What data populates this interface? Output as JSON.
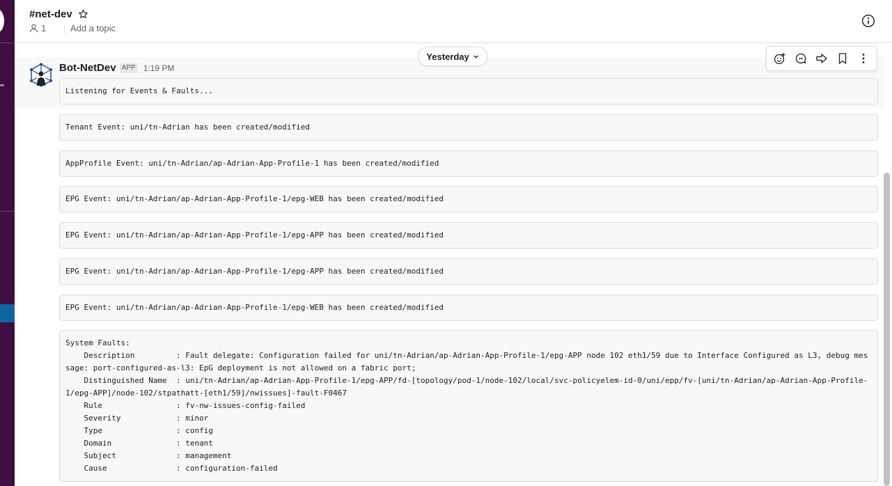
{
  "channel": {
    "name": "#net-dev",
    "member_count": "1",
    "topic_placeholder": "Add a topic"
  },
  "date_divider": {
    "label": "Yesterday"
  },
  "message": {
    "sender": "Bot-NetDev",
    "badge": "APP",
    "time": "1:19 PM"
  },
  "blocks": [
    "Listening for Events & Faults...",
    "Tenant Event: uni/tn-Adrian has been created/modified",
    "AppProfile Event: uni/tn-Adrian/ap-Adrian-App-Profile-1 has been created/modified",
    "EPG Event: uni/tn-Adrian/ap-Adrian-App-Profile-1/epg-WEB has been created/modified",
    "EPG Event: uni/tn-Adrian/ap-Adrian-App-Profile-1/epg-APP has been created/modified",
    "EPG Event: uni/tn-Adrian/ap-Adrian-App-Profile-1/epg-APP has been created/modified",
    "EPG Event: uni/tn-Adrian/ap-Adrian-App-Profile-1/epg-WEB has been created/modified",
    "System Faults:\n    Description         : Fault delegate: Configuration failed for uni/tn-Adrian/ap-Adrian-App-Profile-1/epg-APP node 102 eth1/59 due to Interface Configured as L3, debug message: port-configured-as-l3: EpG deployment is not allowed on a fabric port;\n    Distinguished Name  : uni/tn-Adrian/ap-Adrian-App-Profile-1/epg-APP/fd-[topology/pod-1/node-102/local/svc-policyelem-id-0/uni/epp/fv-[uni/tn-Adrian/ap-Adrian-App-Profile-1/epg-APP]/node-102/stpathatt-[eth1/59]/nwissues]-fault-F0467\n    Rule                : fv-nw-issues-config-failed\n    Severity            : minor\n    Type                : config\n    Domain              : tenant\n    Subject             : management\n    Cause               : configuration-failed"
  ],
  "icons": {
    "star": "star-icon",
    "members": "person-icon",
    "info": "info-icon",
    "actions": [
      "add-reaction-icon",
      "reply-in-thread-icon",
      "share-icon",
      "bookmark-icon",
      "more-actions-icon"
    ]
  },
  "colors": {
    "sidebar": "#3f0e40",
    "sidebar_active": "#1164a3",
    "code_bg": "#f8f8f8"
  }
}
